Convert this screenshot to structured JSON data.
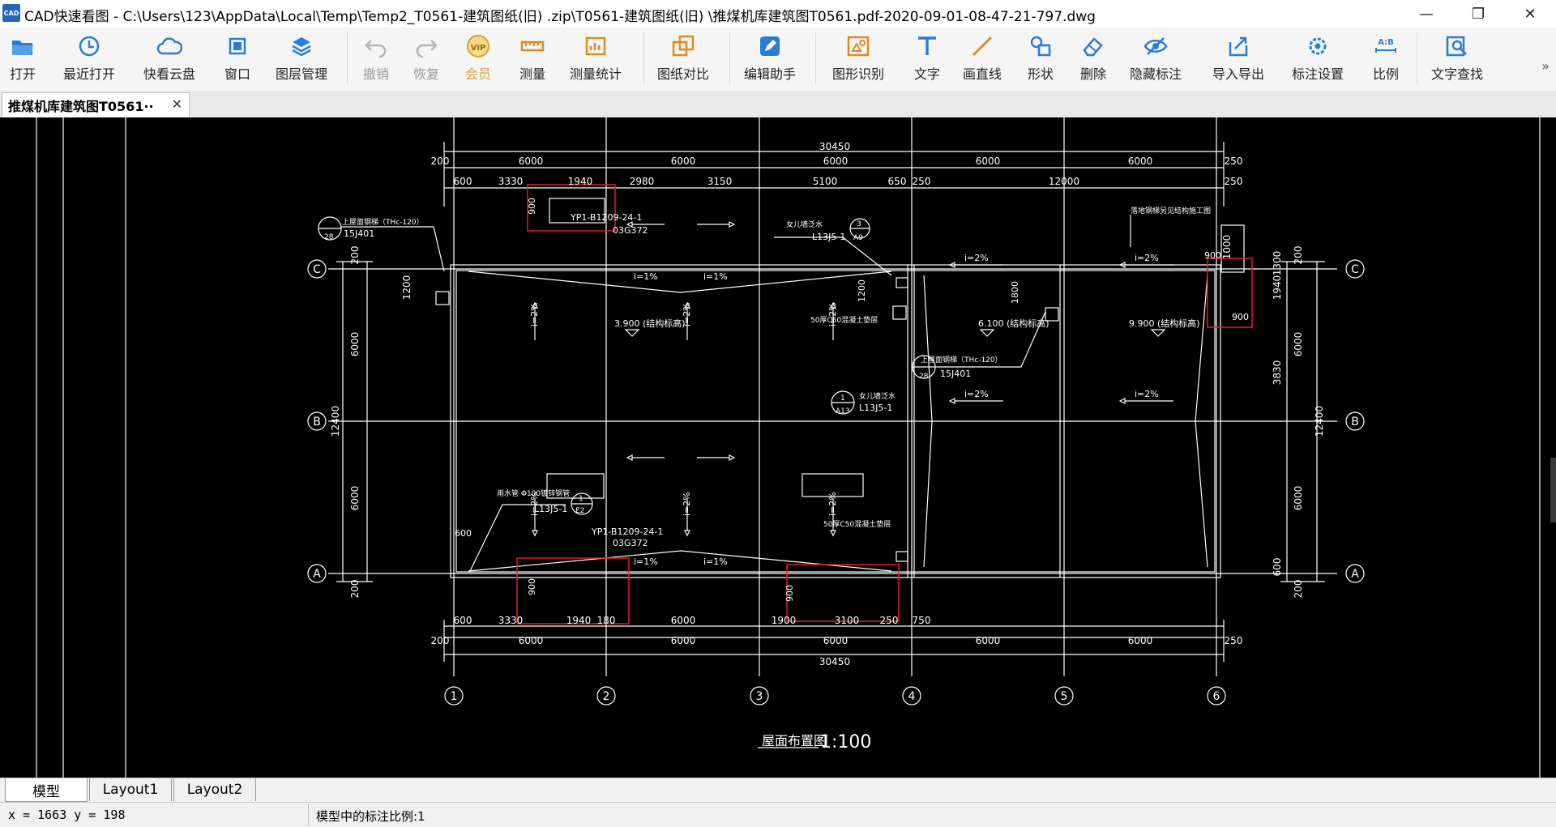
{
  "window": {
    "app_icon_text": "CAD",
    "title": "CAD快速看图 - C:\\Users\\123\\AppData\\Local\\Temp\\Temp2_T0561-建筑图纸(旧) .zip\\T0561-建筑图纸(旧) \\推煤机库建筑图T0561.pdf-2020-09-01-08-47-21-797.dwg",
    "minimize": "—",
    "maximize": "❐",
    "close": "✕"
  },
  "toolbar": {
    "open": "打开",
    "recent": "最近打开",
    "cloud": "快看云盘",
    "window": "窗口",
    "layers": "图层管理",
    "undo": "撤销",
    "redo": "恢复",
    "vip": "会员",
    "vip_badge": "VIP",
    "measure": "测量",
    "measure_stats": "测量统计",
    "compare": "图纸对比",
    "edit_assistant": "编辑助手",
    "shape_recognition": "图形识别",
    "text": "文字",
    "line": "画直线",
    "shape": "形状",
    "delete": "删除",
    "hide_annotation": "隐藏标注",
    "import_export": "导入导出",
    "annotation_settings": "标注设置",
    "ratio": "比例",
    "ratio_icon_text": "A:B",
    "text_search": "文字查找",
    "more": "»"
  },
  "tab": {
    "title": "推煤机库建筑图T0561··",
    "close": "✕"
  },
  "drawing": {
    "title": "屋面布置图",
    "scale": "1:100",
    "axes_x": [
      "1",
      "2",
      "3",
      "4",
      "5",
      "6"
    ],
    "axes_y": [
      "C",
      "B",
      "A"
    ],
    "dim_total": "30450",
    "dim_top_row1": [
      "200",
      "6000",
      "6000",
      "6000",
      "6000",
      "6000",
      "250"
    ],
    "dim_top_row2": [
      "600",
      "3330",
      "1940",
      "2980",
      "3150",
      "5100",
      "650",
      "250",
      "12000",
      "250"
    ],
    "dim_bottom_row1": [
      "600",
      "3330",
      "1940",
      "180",
      "6000",
      "1900",
      "3100",
      "250",
      "750"
    ],
    "dim_bottom_row2": [
      "200",
      "6000",
      "6000",
      "6000",
      "6000",
      "6000",
      "250"
    ],
    "dim_left": [
      "200",
      "6000",
      "12400",
      "6000",
      "200"
    ],
    "dim_left_extra": "1200",
    "dim_right": [
      "1000",
      "1940",
      "1300",
      "200",
      "6000",
      "3830",
      "12400",
      "6000",
      "600",
      "200"
    ],
    "slopes": [
      "i=1%",
      "i=2%"
    ],
    "elevations": [
      "3.900 (结构标高)",
      "6.100 (结构标高)",
      "9.900 (结构标高)"
    ],
    "notes": {
      "parapet": "上屋面钢梯（THc-120）",
      "std_15j401": "15J401",
      "ref_28": "28",
      "yp_label": "YP1-B1209-24-1",
      "std_03g": "03G372",
      "drain_note": "女儿墙泛水",
      "std_l13": "L13J5-1",
      "ref_3": "3",
      "ref_a9": "A9",
      "ref_1": "1",
      "ref_a13": "A13",
      "ref_e2": "E2",
      "ladder_note": "落地钢梯另见结构施工图",
      "c50_note": "50厚C50混凝土垫层",
      "parapet_flash": "女儿墙泛水",
      "drainpipe": "雨水管 Φ100镀锌钢管",
      "dim_900": "900",
      "dim_1200": "1200",
      "dim_1800": "1800",
      "dim_600": "600"
    }
  },
  "layouts": {
    "model": "模型",
    "layout1": "Layout1",
    "layout2": "Layout2"
  },
  "status": {
    "coordinates": "x = 1663  y = 198",
    "annotation_scale": "模型中的标注比例:1"
  },
  "colors": {
    "canvas_bg": "#000000",
    "line": "#ffffff",
    "highlight": "#e02020",
    "accent_blue": "#2b7cd3",
    "accent_orange": "#e08a1e"
  }
}
